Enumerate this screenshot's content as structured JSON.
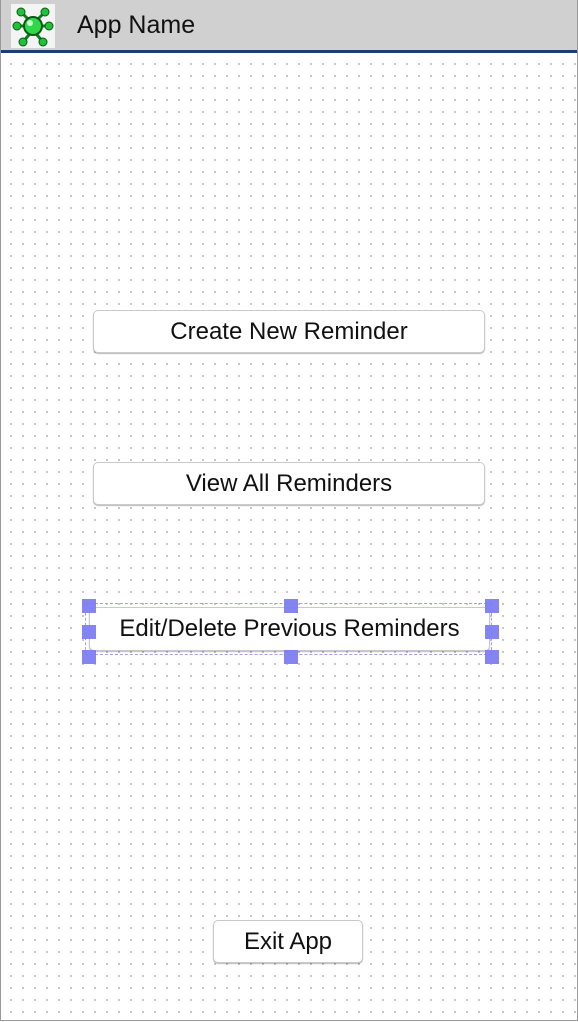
{
  "titlebar": {
    "app_name": "App Name",
    "icon": "green-robot-icon"
  },
  "buttons": {
    "create_label": "Create New Reminder",
    "view_label": "View All Reminders",
    "edit_label": "Edit/Delete Previous Reminders",
    "exit_label": "Exit App"
  },
  "colors": {
    "titlebar_bg": "#d0d0d0",
    "titlebar_border": "#1e3a78",
    "selection_handle": "#7d7df2"
  }
}
